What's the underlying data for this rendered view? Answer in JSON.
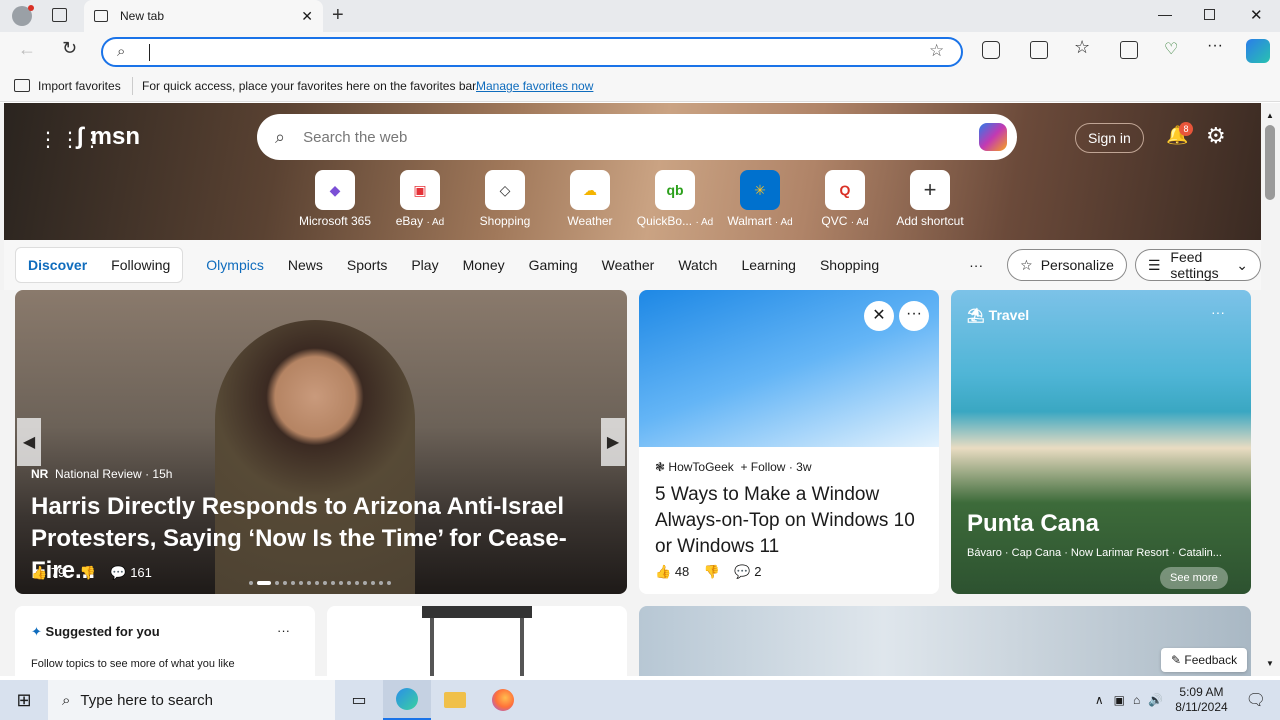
{
  "browser": {
    "tab_title": "New tab",
    "address_value": "",
    "fav_import": "Import favorites",
    "fav_message": "For quick access, place your favorites here on the favorites bar.",
    "fav_link": "Manage favorites now"
  },
  "msn": {
    "logo": "msn",
    "search_placeholder": "Search the web",
    "sign_in": "Sign in",
    "notif_count": "8",
    "shortcuts": [
      {
        "label": "Microsoft 365",
        "ad": ""
      },
      {
        "label": "eBay",
        "ad": "· Ad"
      },
      {
        "label": "Shopping",
        "ad": ""
      },
      {
        "label": "Weather",
        "ad": ""
      },
      {
        "label": "QuickBo...",
        "ad": "· Ad"
      },
      {
        "label": "Walmart",
        "ad": "· Ad"
      },
      {
        "label": "QVC",
        "ad": "· Ad"
      },
      {
        "label": "Add shortcut",
        "ad": ""
      }
    ],
    "nav": {
      "discover": "Discover",
      "following": "Following",
      "items": [
        "Olympics",
        "News",
        "Sports",
        "Play",
        "Money",
        "Gaming",
        "Weather",
        "Watch",
        "Learning",
        "Shopping"
      ],
      "more": "···",
      "personalize": "Personalize",
      "feed_settings": "Feed settings"
    },
    "main_story": {
      "source_badge": "NR",
      "source": "National Review",
      "age": "· 15h",
      "headline": "Harris Directly Responds to Arizona Anti-Israel Protesters, Saying ‘Now Is the Time’ for Cease-Fire...",
      "likes": "79",
      "comments": "161"
    },
    "card2": {
      "source": "HowToGeek",
      "follow": "+ Follow",
      "age": "· 3w",
      "headline": "5 Ways to Make a Window Always-on-Top on Windows 10 or Windows 11",
      "likes": "48",
      "comments": "2"
    },
    "travel": {
      "label": "Travel",
      "title": "Punta Cana",
      "places": "Bávaro · Cap Cana · Now Larimar Resort · Catalin...",
      "see_more": "See more"
    },
    "suggested": {
      "title": "Suggested for you",
      "text": "Follow topics to see more of what you like"
    },
    "feedback": "Feedback"
  },
  "taskbar": {
    "search_placeholder": "Type here to search",
    "time": "5:09 AM",
    "date": "8/11/2024"
  },
  "colors": {
    "accent": "#1a73e8",
    "msn_blue": "#0f6cbd",
    "taskbar": "#d8e1ee"
  }
}
